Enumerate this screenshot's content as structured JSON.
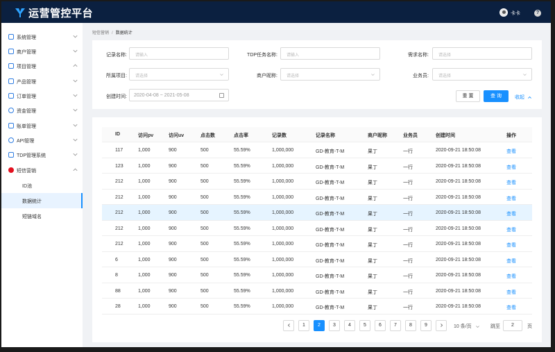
{
  "app": {
    "title": "运营管控平台",
    "user": "卡卡",
    "help": "?"
  },
  "sidebar": {
    "items": [
      {
        "label": "系统管理"
      },
      {
        "label": "商户管理"
      },
      {
        "label": "项目管理"
      },
      {
        "label": "产品管理"
      },
      {
        "label": "订单管理"
      },
      {
        "label": "资金管理"
      },
      {
        "label": "账单管理"
      },
      {
        "label": "API管理"
      },
      {
        "label": "TDP管理系统"
      },
      {
        "label": "短信营销"
      }
    ],
    "sub_items": [
      {
        "label": "ID池"
      },
      {
        "label": "数据统计"
      },
      {
        "label": "短链域名"
      }
    ]
  },
  "breadcrumb": {
    "parent": "短信营销",
    "separator": "/",
    "current": "数据统计"
  },
  "filters": {
    "record_name": {
      "label": "记录名称:",
      "placeholder": "请输入"
    },
    "tdp_task_name": {
      "label": "TDP任务名称:",
      "placeholder": "请输入"
    },
    "demand_name": {
      "label": "需求名称:",
      "placeholder": "请选择"
    },
    "project": {
      "label": "所属项目:",
      "placeholder": "请选择"
    },
    "merchant": {
      "label": "商户昵称:",
      "placeholder": "请选择"
    },
    "salesman": {
      "label": "业务员:",
      "placeholder": "请选择"
    },
    "created_time": {
      "label": "创建时间:",
      "value": "2020-04-08 ~ 2021-05-08"
    },
    "reset_label": "重 置",
    "query_label": "查 询",
    "collapse_label": "收起"
  },
  "table": {
    "columns": [
      "ID",
      "访问pv",
      "访问uv",
      "点击数",
      "点击率",
      "记录数",
      "记录名称",
      "商户昵称",
      "业务员",
      "创建时间",
      "操作"
    ],
    "rows": [
      [
        "117",
        "1,000",
        "900",
        "500",
        "55.59%",
        "1,000,000",
        "GD-教育-T-M",
        "果丁",
        "一行",
        "2020-09-21  18:50:08",
        "查看"
      ],
      [
        "123",
        "1,000",
        "900",
        "500",
        "55.59%",
        "1,000,000",
        "GD-教育-T-M",
        "果丁",
        "一行",
        "2020-09-21  18:50:08",
        "查看"
      ],
      [
        "212",
        "1,000",
        "900",
        "500",
        "55.59%",
        "1,000,000",
        "GD-教育-T-M",
        "果丁",
        "一行",
        "2020-09-21  18:50:08",
        "查看"
      ],
      [
        "212",
        "1,000",
        "900",
        "500",
        "55.59%",
        "1,000,000",
        "GD-教育-T-M",
        "果丁",
        "一行",
        "2020-09-21  18:50:08",
        "查看"
      ],
      [
        "212",
        "1,000",
        "900",
        "500",
        "55.59%",
        "1,000,000",
        "GD-教育-T-M",
        "果丁",
        "一行",
        "2020-09-21  18:50:08",
        "查看"
      ],
      [
        "212",
        "1,000",
        "900",
        "500",
        "55.59%",
        "1,000,000",
        "GD-教育-T-M",
        "果丁",
        "一行",
        "2020-09-21  18:50:08",
        "查看"
      ],
      [
        "212",
        "1,000",
        "900",
        "500",
        "55.59%",
        "1,000,000",
        "GD-教育-T-M",
        "果丁",
        "一行",
        "2020-09-21  18:50:08",
        "查看"
      ],
      [
        "6",
        "1,000",
        "900",
        "500",
        "55.59%",
        "1,000,000",
        "GD-教育-T-M",
        "果丁",
        "一行",
        "2020-09-21  18:50:08",
        "查看"
      ],
      [
        "8",
        "1,000",
        "900",
        "500",
        "55.59%",
        "1,000,000",
        "GD-教育-T-M",
        "果丁",
        "一行",
        "2020-09-21  18:50:08",
        "查看"
      ],
      [
        "88",
        "1,000",
        "900",
        "500",
        "55.59%",
        "1,000,000",
        "GD-教育-T-M",
        "果丁",
        "一行",
        "2020-09-21  18:50:08",
        "查看"
      ],
      [
        "28",
        "1,000",
        "900",
        "500",
        "55.59%",
        "1,000,000",
        "GD-教育-T-M",
        "果丁",
        "一行",
        "2020-09-21  18:50:08",
        "查看"
      ]
    ]
  },
  "pagination": {
    "pages": [
      "1",
      "2",
      "3",
      "4",
      "5",
      "6",
      "7",
      "8",
      "9"
    ],
    "current": "2",
    "page_size": "10 条/页",
    "jump_label": "跳至",
    "jump_value": "2",
    "jump_unit": "页"
  },
  "colors": {
    "topbar": "#0b2040",
    "accent": "#1890ff",
    "marketing_dot": "#e3101e",
    "row_highlight": "#e6f4ff"
  }
}
